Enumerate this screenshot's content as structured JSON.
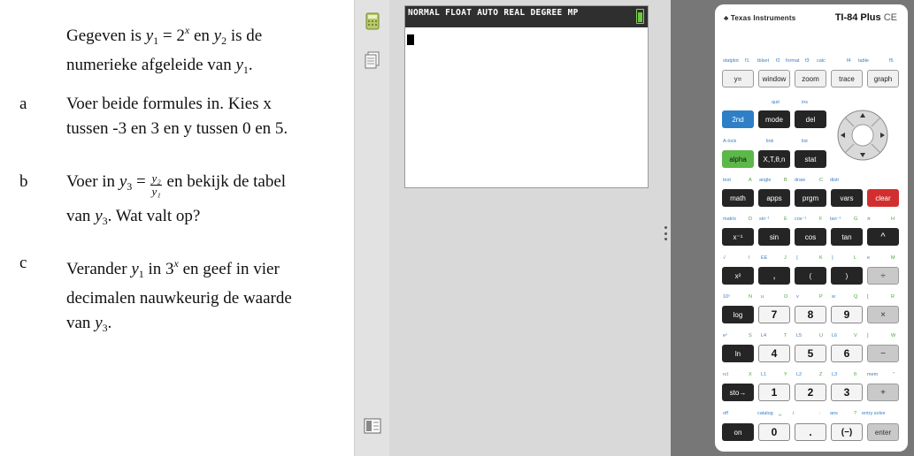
{
  "exercise": {
    "intro_line1_a": "Gegeven is ",
    "intro_y": "y",
    "intro_sub1": "1",
    "intro_eq": " = 2",
    "intro_x": "x",
    "intro_line1_b": " en ",
    "intro_y2": "y",
    "intro_sub2": "2",
    "intro_line1_c": " is de",
    "intro_line2_a": "numerieke afgeleide van ",
    "intro_line2_y": "y",
    "intro_line2_sub": "1",
    "intro_line2_end": ".",
    "a_letter": "a",
    "a_line1": "Voer beide formules in. Kies x",
    "a_line2": "tussen -3 en 3 en y tussen 0 en 5.",
    "b_letter": "b",
    "b_pre": "Voer in ",
    "b_y3": "y",
    "b_sub3": "3",
    "b_eq": " = ",
    "b_num": "y₂",
    "b_den": "y₁",
    "b_post": " en bekijk de tabel",
    "b_line2_a": "van ",
    "b_line2_y": "y",
    "b_line2_sub": "3",
    "b_line2_end": ". Wat valt op?",
    "c_letter": "c",
    "c_pre": "Verander ",
    "c_y1": "y",
    "c_sub1": "1",
    "c_mid": " in 3",
    "c_x": "x",
    "c_post": " en geef in vier",
    "c_line2": "decimalen nauwkeurig de waarde",
    "c_line3_a": "van ",
    "c_line3_y": "y",
    "c_line3_sub": "3",
    "c_line3_end": "."
  },
  "screen": {
    "status_text": "NORMAL FLOAT AUTO REAL DEGREE MP"
  },
  "calculator": {
    "brand": "Texas Instruments",
    "model": "TI-84 Plus",
    "model_suffix": "CE",
    "keys": {
      "y_eq": "y=",
      "window": "window",
      "zoom": "zoom",
      "trace": "trace",
      "graph": "graph",
      "second": "2nd",
      "mode": "mode",
      "del": "del",
      "alpha": "alpha",
      "xton": "X,T,θ,n",
      "stat": "stat",
      "math": "math",
      "apps": "apps",
      "prgm": "prgm",
      "vars": "vars",
      "clear": "clear",
      "xinv": "x⁻¹",
      "sin": "sin",
      "cos": "cos",
      "tan": "tan",
      "caret": "^",
      "xsq": "x²",
      "comma": ",",
      "lparen": "(",
      "rparen": ")",
      "div": "÷",
      "log": "log",
      "k7": "7",
      "k8": "8",
      "k9": "9",
      "mul": "×",
      "ln": "ln",
      "k4": "4",
      "k5": "5",
      "k6": "6",
      "minus": "−",
      "sto": "sto→",
      "k1": "1",
      "k2": "2",
      "k3": "3",
      "plus": "+",
      "on": "on",
      "k0": "0",
      "dot": ".",
      "neg": "(−)",
      "enter": "enter"
    },
    "labels": {
      "r1": [
        "statplot",
        "f1",
        "tblset",
        "f2",
        "format",
        "f3",
        "calc",
        "f4",
        "table",
        "f5"
      ],
      "r2": [
        "quit",
        "ins"
      ],
      "r3": [
        "A-lock",
        "link",
        "list"
      ],
      "r4": [
        "test",
        "A",
        "angle",
        "B",
        "draw",
        "C",
        "distr"
      ],
      "r5": [
        "matrix",
        "D",
        "sin⁻¹",
        "E",
        "cos⁻¹",
        "F",
        "tan⁻¹",
        "G",
        "π",
        "H"
      ],
      "r6": [
        "√",
        "I",
        "EE",
        "J",
        "{",
        "K",
        "}",
        "L",
        "e",
        "M"
      ],
      "r7": [
        "10ˣ",
        "N",
        "u",
        "O",
        "v",
        "P",
        "w",
        "Q",
        "[",
        "R"
      ],
      "r8": [
        "eˣ",
        "S",
        "L4",
        "T",
        "L5",
        "U",
        "L6",
        "V",
        "]",
        "W"
      ],
      "r9": [
        "rcl",
        "X",
        "L1",
        "Y",
        "L2",
        "Z",
        "L3",
        "θ",
        "mem",
        "\""
      ],
      "r10": [
        "off",
        "catalog",
        "␣",
        "i",
        ":",
        "ans",
        "?",
        "entry solve"
      ]
    }
  }
}
